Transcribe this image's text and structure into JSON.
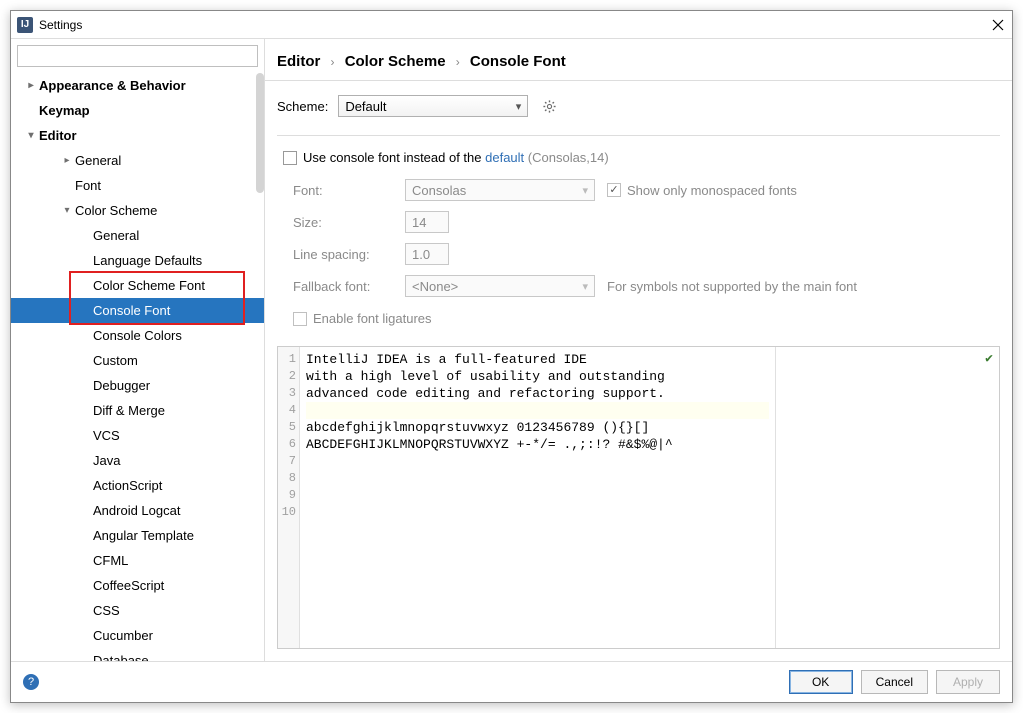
{
  "window": {
    "title": "Settings"
  },
  "search": {
    "placeholder": ""
  },
  "tree": {
    "items": [
      {
        "label": "Appearance & Behavior",
        "level": 0,
        "arrow": "right"
      },
      {
        "label": "Keymap",
        "level": 0,
        "arrow": ""
      },
      {
        "label": "Editor",
        "level": 0,
        "arrow": "down"
      },
      {
        "label": "General",
        "level": 2,
        "arrow": "right"
      },
      {
        "label": "Font",
        "level": 2,
        "arrow": ""
      },
      {
        "label": "Color Scheme",
        "level": 2,
        "arrow": "down"
      },
      {
        "label": "General",
        "level": 3,
        "arrow": ""
      },
      {
        "label": "Language Defaults",
        "level": 3,
        "arrow": ""
      },
      {
        "label": "Color Scheme Font",
        "level": 3,
        "arrow": ""
      },
      {
        "label": "Console Font",
        "level": 3,
        "arrow": "",
        "selected": true
      },
      {
        "label": "Console Colors",
        "level": 3,
        "arrow": ""
      },
      {
        "label": "Custom",
        "level": 3,
        "arrow": ""
      },
      {
        "label": "Debugger",
        "level": 3,
        "arrow": ""
      },
      {
        "label": "Diff & Merge",
        "level": 3,
        "arrow": ""
      },
      {
        "label": "VCS",
        "level": 3,
        "arrow": ""
      },
      {
        "label": "Java",
        "level": 3,
        "arrow": ""
      },
      {
        "label": "ActionScript",
        "level": 3,
        "arrow": ""
      },
      {
        "label": "Android Logcat",
        "level": 3,
        "arrow": ""
      },
      {
        "label": "Angular Template",
        "level": 3,
        "arrow": ""
      },
      {
        "label": "CFML",
        "level": 3,
        "arrow": ""
      },
      {
        "label": "CoffeeScript",
        "level": 3,
        "arrow": ""
      },
      {
        "label": "CSS",
        "level": 3,
        "arrow": ""
      },
      {
        "label": "Cucumber",
        "level": 3,
        "arrow": ""
      },
      {
        "label": "Database",
        "level": 3,
        "arrow": ""
      }
    ]
  },
  "breadcrumb": {
    "a": "Editor",
    "b": "Color Scheme",
    "c": "Console Font"
  },
  "scheme": {
    "label": "Scheme:",
    "value": "Default"
  },
  "useConsole": {
    "prefix": "Use console font instead of the ",
    "link": "default",
    "suffix": " (Consolas,14)"
  },
  "form": {
    "fontLabel": "Font:",
    "fontValue": "Consolas",
    "showMono": "Show only monospaced fonts",
    "sizeLabel": "Size:",
    "sizeValue": "14",
    "lineSpacingLabel": "Line spacing:",
    "lineSpacingValue": "1.0",
    "fallbackLabel": "Fallback font:",
    "fallbackValue": "<None>",
    "fallbackNote": "For symbols not supported by the main font",
    "ligatures": "Enable font ligatures"
  },
  "preview": {
    "lines": [
      "IntelliJ IDEA is a full-featured IDE",
      "with a high level of usability and outstanding",
      "advanced code editing and refactoring support.",
      "",
      "abcdefghijklmnopqrstuvwxyz 0123456789 (){}[]",
      "ABCDEFGHIJKLMNOPQRSTUVWXYZ +-*/= .,;:!? #&$%@|^",
      "",
      "",
      "",
      ""
    ],
    "currentLine": 4
  },
  "footer": {
    "ok": "OK",
    "cancel": "Cancel",
    "apply": "Apply"
  }
}
